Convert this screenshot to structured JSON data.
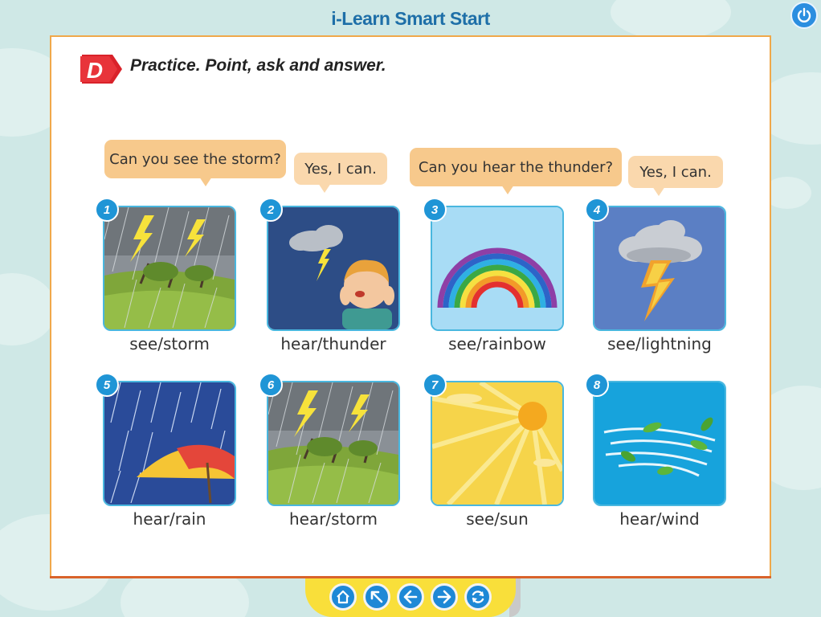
{
  "app": {
    "title": "i-Learn Smart Start"
  },
  "lesson": {
    "section_letter": "D",
    "instruction": "Practice. Point, ask and answer."
  },
  "bubbles": [
    {
      "text": "Can you see the storm?"
    },
    {
      "text": "Yes, I can."
    },
    {
      "text": "Can you hear the thunder?"
    },
    {
      "text": "Yes, I can."
    }
  ],
  "cards": [
    {
      "number": "1",
      "caption": "see/storm",
      "picture": "storm"
    },
    {
      "number": "2",
      "caption": "hear/thunder",
      "picture": "thunder"
    },
    {
      "number": "3",
      "caption": "see/rainbow",
      "picture": "rainbow"
    },
    {
      "number": "4",
      "caption": "see/lightning",
      "picture": "lightning"
    },
    {
      "number": "5",
      "caption": "hear/rain",
      "picture": "rain"
    },
    {
      "number": "6",
      "caption": "hear/storm",
      "picture": "storm"
    },
    {
      "number": "7",
      "caption": "see/sun",
      "picture": "sun"
    },
    {
      "number": "8",
      "caption": "hear/wind",
      "picture": "wind"
    }
  ],
  "navigation": [
    {
      "icon": "home-icon"
    },
    {
      "icon": "arrow-up-left-icon"
    },
    {
      "icon": "arrow-left-icon"
    },
    {
      "icon": "arrow-right-icon"
    },
    {
      "icon": "refresh-icon"
    }
  ],
  "colors": {
    "background": "#cfe8e6",
    "title": "#1e6fa8",
    "page_border": "#f0a84a",
    "bubble": "#f7c98c",
    "card_border": "#49b7df",
    "nav_bar": "#f9df3a",
    "nav_button": "#1e88d6"
  }
}
